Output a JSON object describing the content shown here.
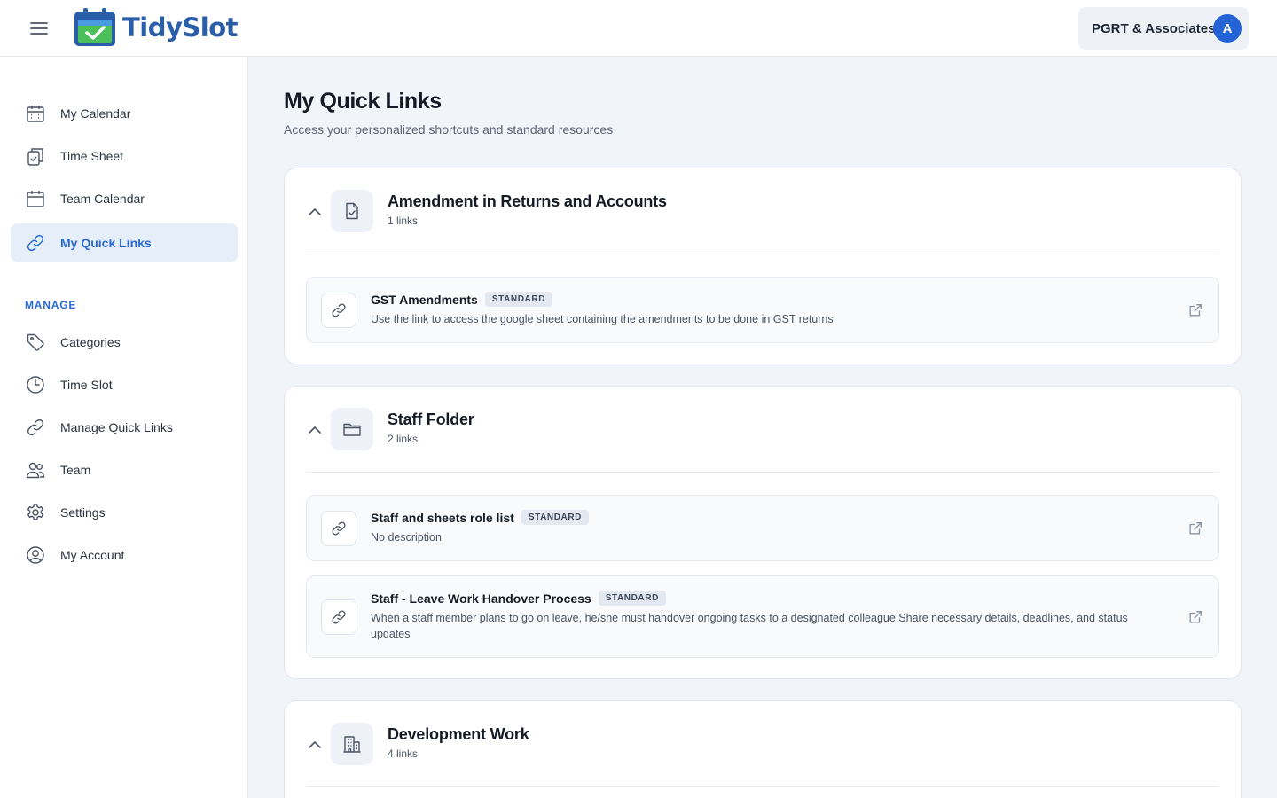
{
  "header": {
    "app_name": "TidySlot",
    "org_name": "PGRT & Associates",
    "avatar_initial": "A",
    "brand_color": "#2b5ea8",
    "accent_color": "#2463d6"
  },
  "sidebar": {
    "items": [
      {
        "label": "My Calendar",
        "icon": "calendar-grid-icon"
      },
      {
        "label": "Time Sheet",
        "icon": "clipboard-check-icon"
      },
      {
        "label": "Team Calendar",
        "icon": "calendar-icon"
      },
      {
        "label": "My Quick Links",
        "icon": "link-icon",
        "active": true
      }
    ],
    "manage_label": "MANAGE",
    "manage_items": [
      {
        "label": "Categories",
        "icon": "tag-icon"
      },
      {
        "label": "Time Slot",
        "icon": "clock-icon"
      },
      {
        "label": "Manage Quick Links",
        "icon": "link-icon"
      },
      {
        "label": "Team",
        "icon": "users-icon"
      },
      {
        "label": "Settings",
        "icon": "gear-icon"
      },
      {
        "label": "My Account",
        "icon": "user-circle-icon"
      }
    ]
  },
  "main": {
    "title": "My Quick Links",
    "subtitle": "Access your personalized shortcuts and standard resources",
    "categories": [
      {
        "title": "Amendment in Returns and Accounts",
        "count": "1 links",
        "icon": "document-check-icon",
        "links": [
          {
            "title": "GST Amendments",
            "badge": "STANDARD",
            "description": "Use the link to access the google sheet containing the amendments to be done in GST returns"
          }
        ]
      },
      {
        "title": "Staff Folder",
        "count": "2 links",
        "icon": "folder-icon",
        "links": [
          {
            "title": "Staff and sheets role list",
            "badge": "STANDARD",
            "description": "No description"
          },
          {
            "title": "Staff - Leave Work Handover Process",
            "badge": "STANDARD",
            "description": "When a staff member plans to go on leave, he/she must handover ongoing tasks to a designated colleague Share necessary details, deadlines, and status updates"
          }
        ]
      },
      {
        "title": "Development Work",
        "count": "4 links",
        "icon": "building-icon",
        "links": []
      }
    ]
  }
}
